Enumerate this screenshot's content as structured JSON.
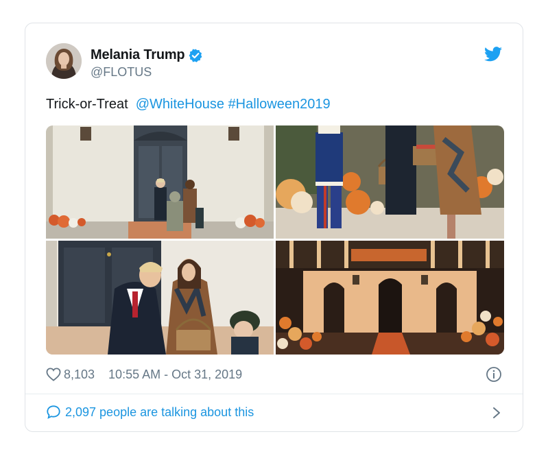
{
  "author": {
    "display_name": "Melania Trump",
    "handle": "@FLOTUS",
    "verified": true
  },
  "tweet": {
    "text_plain": "Trick-or-Treat",
    "mention": "@WhiteHouse",
    "hashtag": "#Halloween2019"
  },
  "media": {
    "count": 4
  },
  "meta": {
    "likes": "8,103",
    "timestamp": "10:55 AM - Oct 31, 2019"
  },
  "footer": {
    "conversation": "2,097 people are talking about this"
  },
  "colors": {
    "link": "#1b95e0",
    "text": "#14171a",
    "secondary": "#657786",
    "border": "#dfe3e7"
  }
}
